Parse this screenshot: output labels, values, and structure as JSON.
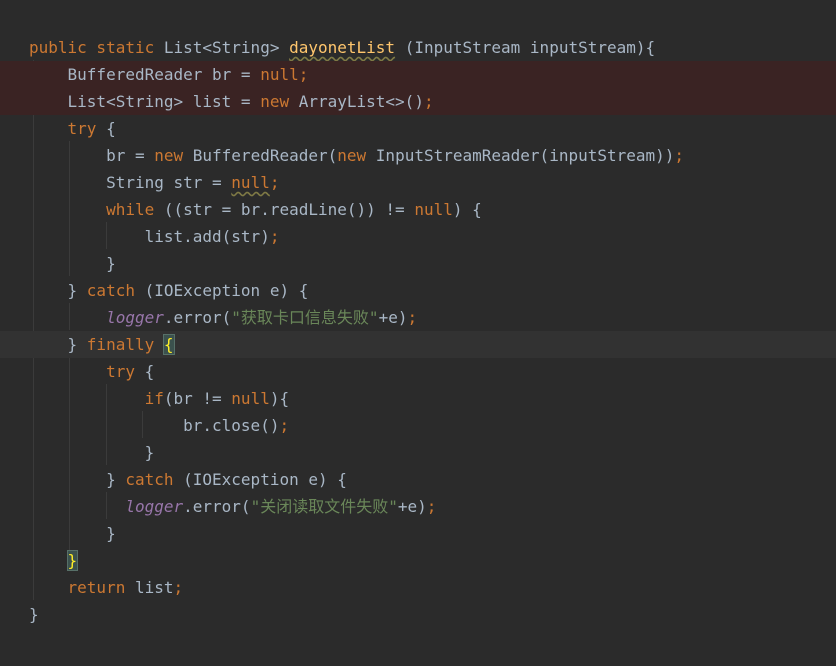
{
  "lines": [
    {
      "tokens": [
        [
          "kw",
          "public static "
        ],
        [
          "pl",
          "List<String> "
        ],
        [
          "fn",
          "dayonetList"
        ],
        [
          "pl",
          " (InputStream inputStream){"
        ]
      ]
    },
    {
      "tokens": [
        [
          "pl",
          "    BufferedReader br = "
        ],
        [
          "kw",
          "null;"
        ]
      ]
    },
    {
      "tokens": [
        [
          "pl",
          "    List<String> list = "
        ],
        [
          "kw",
          "new "
        ],
        [
          "pl",
          "ArrayList<>()"
        ],
        [
          "kw",
          ";"
        ]
      ]
    },
    {
      "tokens": [
        [
          "kw",
          "    try "
        ],
        [
          "pl",
          "{"
        ]
      ]
    },
    {
      "tokens": [
        [
          "pl",
          "        br = "
        ],
        [
          "kw",
          "new "
        ],
        [
          "pl",
          "BufferedReader("
        ],
        [
          "kw",
          "new "
        ],
        [
          "pl",
          "InputStreamReader(inputStream))"
        ],
        [
          "kw",
          ";"
        ]
      ]
    },
    {
      "tokens": [
        [
          "pl",
          "        String str = "
        ],
        [
          "kwul",
          "null"
        ],
        [
          "kw",
          ";"
        ]
      ]
    },
    {
      "tokens": [
        [
          "kw",
          "        while "
        ],
        [
          "pl",
          "((str = br.readLine()) != "
        ],
        [
          "kw",
          "null"
        ],
        [
          "pl",
          ") {"
        ]
      ]
    },
    {
      "tokens": [
        [
          "pl",
          "            list.add(str)"
        ],
        [
          "kw",
          ";"
        ]
      ]
    },
    {
      "tokens": [
        [
          "pl",
          "        }"
        ]
      ]
    },
    {
      "tokens": [
        [
          "pl",
          "    } "
        ],
        [
          "kw",
          "catch "
        ],
        [
          "pl",
          "(IOException e) {"
        ]
      ]
    },
    {
      "tokens": [
        [
          "pl",
          "        "
        ],
        [
          "fld",
          "logger"
        ],
        [
          "pl",
          ".error("
        ],
        [
          "str",
          "\"获取卡口信息失败\""
        ],
        [
          "pl",
          "+e)"
        ],
        [
          "kw",
          ";"
        ]
      ]
    },
    {
      "tokens": [
        [
          "pl",
          "    } "
        ],
        [
          "kw",
          "finally "
        ],
        [
          "brace",
          "{"
        ]
      ]
    },
    {
      "tokens": [
        [
          "kw",
          "        try "
        ],
        [
          "pl",
          "{"
        ]
      ]
    },
    {
      "tokens": [
        [
          "kw",
          "            if"
        ],
        [
          "pl",
          "(br != "
        ],
        [
          "kw",
          "null"
        ],
        [
          "pl",
          "){"
        ]
      ]
    },
    {
      "tokens": [
        [
          "pl",
          "                br.close()"
        ],
        [
          "kw",
          ";"
        ]
      ]
    },
    {
      "tokens": [
        [
          "pl",
          "            }"
        ]
      ]
    },
    {
      "tokens": [
        [
          "pl",
          "        } "
        ],
        [
          "kw",
          "catch "
        ],
        [
          "pl",
          "(IOException e) {"
        ]
      ]
    },
    {
      "tokens": [
        [
          "pl",
          "          "
        ],
        [
          "fld",
          "logger"
        ],
        [
          "pl",
          ".error("
        ],
        [
          "str",
          "\"关闭读取文件失败\""
        ],
        [
          "pl",
          "+e)"
        ],
        [
          "kw",
          ";"
        ]
      ]
    },
    {
      "tokens": [
        [
          "pl",
          "        }"
        ]
      ]
    },
    {
      "tokens": [
        [
          "pl",
          "    "
        ],
        [
          "brace",
          "}"
        ]
      ]
    },
    {
      "tokens": [
        [
          "kw",
          "    return "
        ],
        [
          "pl",
          "list"
        ],
        [
          "kw",
          ";"
        ]
      ]
    },
    {
      "tokens": [
        [
          "pl",
          "}"
        ]
      ]
    }
  ],
  "colors": {
    "background": "#2b2b2b",
    "keyword": "#cc7832",
    "plain": "#a9b7c6",
    "method_decl": "#ffc66d",
    "string": "#6a8759",
    "field": "#9876aa",
    "warning_line": "#3a2323",
    "caret_line": "#323232"
  }
}
